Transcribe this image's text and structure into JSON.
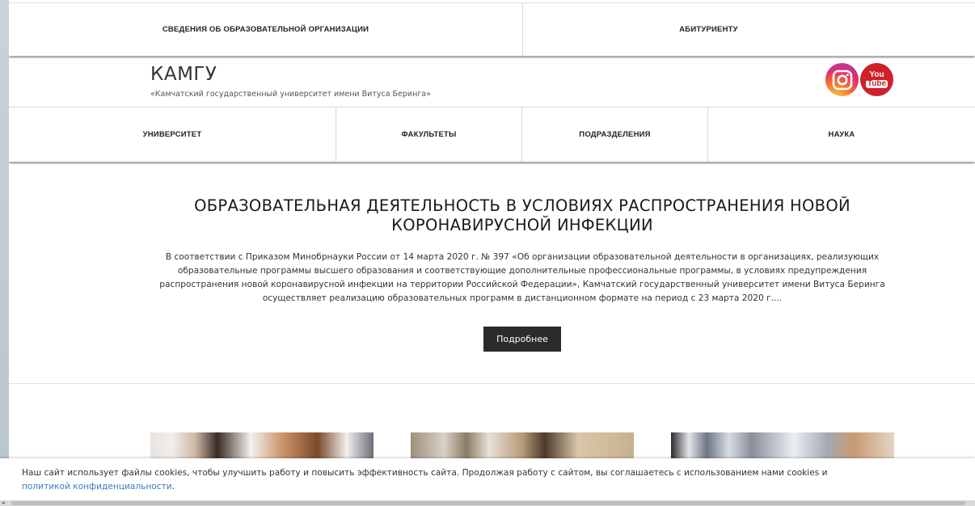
{
  "topnav": {
    "items": [
      "СВЕДЕНИЯ ОБ ОБРАЗОВАТЕЛЬНОЙ ОРГАНИЗАЦИИ",
      "АБИТУРИЕНТУ"
    ]
  },
  "header": {
    "title": "КАМГУ",
    "subtitle": "«Камчатский государственный университет имени Витуса Беринга»",
    "social": {
      "instagram_icon": "instagram-icon",
      "youtube_top": "You",
      "youtube_bottom": "Tube"
    }
  },
  "mainnav": {
    "items": [
      "УНИВЕРСИТЕТ",
      "ФАКУЛЬТЕТЫ",
      "ПОДРАЗДЕЛЕНИЯ",
      "НАУКА"
    ]
  },
  "news": {
    "title": "ОБРАЗОВАТЕЛЬНАЯ ДЕЯТЕЛЬНОСТЬ В УСЛОВИЯХ РАСПРОСТРАНЕНИЯ НОВОЙ КОРОНАВИРУСНОЙ ИНФЕКЦИИ",
    "body": "В соответствии с Приказом Минобрнауки России от 14 марта 2020 г. № 397 «Об организации образовательной деятельности в организациях, реализующих образовательные программы высшего образования и соответствующие дополнительные профессиональные программы, в условиях предупреждения распространения новой коронавирусной инфекции на территории Российской Федерации», Камчатский государственный университет имени Витуса Беринга осуществляет реализацию образовательных программ в дистанционном формате на период с 23 марта 2020 г....",
    "button": "Подробнее"
  },
  "cookie": {
    "text": "Наш сайт использует файлы cookies, чтобы улучшить работу и повысить эффективность сайта. Продолжая работу с сайтом, вы соглашаетесь с использованием нами cookies и ",
    "link": "политикой конфиденциальности",
    "end": "."
  },
  "colors": {
    "button_bg": "#2b2b2b",
    "link": "#3b7bbf",
    "youtube": "#d0202a"
  }
}
